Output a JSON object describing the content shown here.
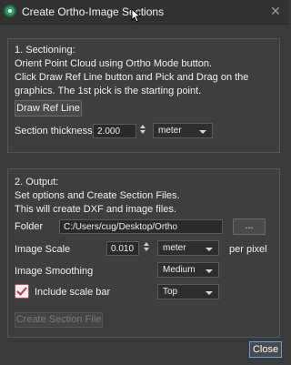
{
  "window": {
    "title": "Create Ortho-Image Sections"
  },
  "sectioning": {
    "heading": "1. Sectioning:",
    "line1": "Orient Point Cloud using Ortho Mode button.",
    "line2": "Click Draw Ref Line button and Pick and Drag on the",
    "line3": "graphics. The 1st pick is the starting point.",
    "draw_button": "Draw Ref Line",
    "thickness_label": "Section thickness",
    "thickness_value": "2.000",
    "thickness_unit": "meter"
  },
  "output": {
    "heading": "2. Output:",
    "line1": "Set options and Create Section Files.",
    "line2": "This will create DXF and image files.",
    "folder_label": "Folder",
    "folder_value": "C:/Users/cug/Desktop/Ortho",
    "browse_button": "...",
    "scale_label": "Image Scale",
    "scale_value": "0.010",
    "scale_unit": "meter",
    "scale_suffix": "per pixel",
    "smoothing_label": "Image Smoothing",
    "smoothing_value": "Medium",
    "scalebar_label": "Include scale bar",
    "scalebar_checked": true,
    "scalebar_position": "Top",
    "create_button": "Create Section File"
  },
  "footer": {
    "close_button": "Close"
  },
  "colors": {
    "accent": "#5aa0e6",
    "check": "#c0304a"
  }
}
